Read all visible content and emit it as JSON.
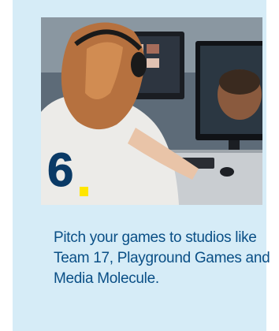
{
  "card": {
    "number": "6",
    "caption": "Pitch your games to studios like Team 17, Playground Games and Media Molecule.",
    "photo_alt_icon": "photo-student-at-computer"
  },
  "colors": {
    "card_background": "#d6ecf7",
    "number": "#0a3a66",
    "number_dot": "#ffe600",
    "caption_text": "#0a4f86"
  }
}
